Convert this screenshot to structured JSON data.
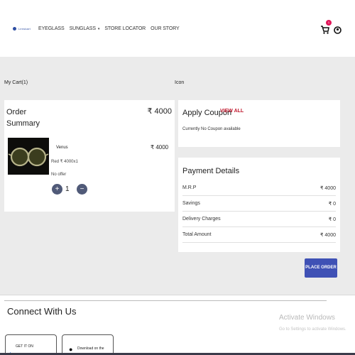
{
  "header": {
    "brand": "Lenskart",
    "nav": [
      {
        "label": "EYEGLASS"
      },
      {
        "label": "SUNGLASS",
        "caret": "▾"
      },
      {
        "label": "STORE LOCATOR"
      },
      {
        "label": "OUR STORY"
      }
    ],
    "cart_count": "1"
  },
  "cart": {
    "title": "My Cart(1)",
    "side_label": "Icon",
    "order_summary_label": "Order Summary",
    "order_total": "₹ 4000",
    "product": {
      "name": "Venus",
      "price": "₹ 4000",
      "detail": "Red ₹ 4000x1",
      "offer": "No offer",
      "quantity": "1"
    }
  },
  "coupon": {
    "title": "Apply Coupon",
    "view_all": "VIEW ALL",
    "note": "Currently No Coupon available"
  },
  "payment": {
    "title": "Payment Details",
    "rows": [
      {
        "label": "M.R.P",
        "value": "₹ 4000"
      },
      {
        "label": "Savings",
        "value": "₹ 0"
      },
      {
        "label": "Delivery Charges",
        "value": "₹ 0"
      },
      {
        "label": "Total Amount",
        "value": "₹ 4000"
      }
    ],
    "place_order": "PLACE ORDER"
  },
  "footer": {
    "connect": "Connect With Us",
    "google_play_small": "GET IT ON",
    "app_store_small": "Download on the",
    "activate_title": "Activate Windows",
    "activate_sub": "Go to Settings to activate Windows."
  },
  "colors": {
    "accent": "#3f51b5",
    "badge": "#e2175a",
    "view_all": "#c0182d",
    "qty_button": "#505a78"
  }
}
